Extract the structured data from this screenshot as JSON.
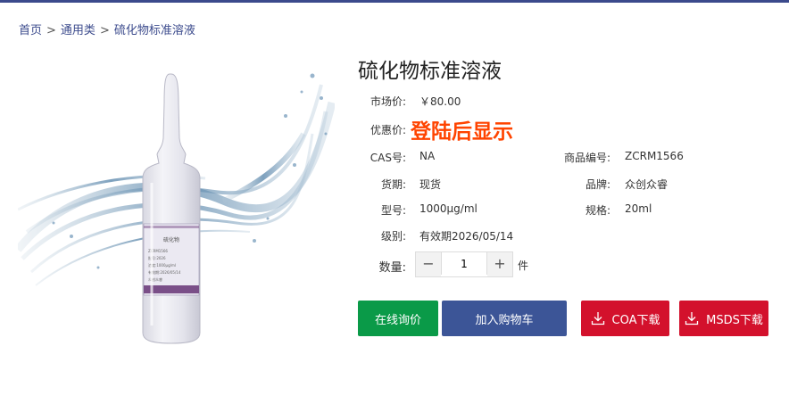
{
  "breadcrumb": {
    "items": [
      "首页",
      "通用类",
      "硫化物标准溶液"
    ],
    "separator": ">"
  },
  "product": {
    "title": "硫化物标准溶液",
    "market_price_label": "市场价:",
    "market_price": "￥80.00",
    "promo_label": "优惠价:",
    "promo_text": "登陆后显示",
    "cas_label": "CAS号:",
    "cas": "NA",
    "code_label": "商品编号:",
    "code": "ZCRM1566",
    "stock_label": "货期:",
    "stock": "现货",
    "brand_label": "品牌:",
    "brand": "众创众睿",
    "model_label": "型号:",
    "model": "1000μg/ml",
    "spec_label": "规格:",
    "spec": "20ml",
    "level_label": "级别:",
    "level": "有效期2026/05/14",
    "qty_label": "数量:",
    "qty_value": "1",
    "qty_unit": "件",
    "vial_label_lines": [
      "硫化物",
      "ZCRM1566",
      "批号:2026",
      "浓度:1000μg/ml",
      "有效期:2026/05/14",
      "众创众睿"
    ]
  },
  "buttons": {
    "inquiry": "在线询价",
    "add_cart": "加入购物车",
    "coa": "COA下载",
    "msds": "MSDS下载"
  },
  "colors": {
    "accent_blue": "#3c5597",
    "green": "#0a9a48",
    "red": "#d3112c",
    "promo": "#ff4400"
  },
  "icons": {
    "download": "download-icon",
    "minus": "minus-icon",
    "plus": "plus-icon"
  }
}
